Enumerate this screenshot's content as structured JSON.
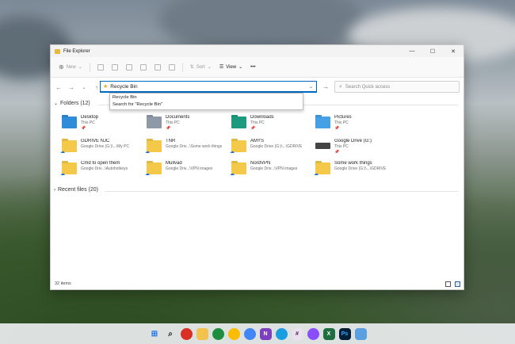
{
  "window": {
    "title": "File Explorer",
    "controls": [
      "—",
      "☐",
      "✕"
    ]
  },
  "toolbar": {
    "new_label": "New",
    "sort_label": "Sort",
    "view_label": "View",
    "more_label": "•••"
  },
  "address": {
    "value": "Recycle Bin",
    "suggestions": [
      "Recycle Bin",
      "Search for \"Recycle Bin\""
    ]
  },
  "search": {
    "placeholder": "Search Quick access"
  },
  "folders_header": "Folders (12)",
  "recent_header": "Recent files (20)",
  "folders": [
    {
      "name": "Desktop",
      "sub": "This PC",
      "pin": "📌",
      "icon": "desktop-folder-icon"
    },
    {
      "name": "Documents",
      "sub": "This PC",
      "pin": "📌",
      "icon": "documents-folder-icon"
    },
    {
      "name": "Downloads",
      "sub": "This PC",
      "pin": "📌",
      "icon": "downloads-folder-icon"
    },
    {
      "name": "Pictures",
      "sub": "This PC",
      "pin": "📌",
      "icon": "pictures-folder-icon"
    },
    {
      "name": "GDRIVE NJC",
      "sub": "Google Drive (G:)\\...\\My PC",
      "pin": "",
      "icon": "cloud-folder-icon"
    },
    {
      "name": "TNR",
      "sub": "Google Driv...\\Some work things",
      "pin": "",
      "icon": "cloud-folder-icon"
    },
    {
      "name": "AMYS",
      "sub": "Google Drive (G:)\\...\\GDRIVE",
      "pin": "",
      "icon": "cloud-folder-icon"
    },
    {
      "name": "Google Drive (G:)",
      "sub": "This PC",
      "pin": "📌",
      "icon": "drive-icon"
    },
    {
      "name": "Cmd to open them",
      "sub": "Google Driv...\\Autohotkeys",
      "pin": "",
      "icon": "cloud-folder-icon"
    },
    {
      "name": "Mullvad",
      "sub": "Google Driv...\\VPN images",
      "pin": "",
      "icon": "cloud-folder-icon"
    },
    {
      "name": "NordVPN",
      "sub": "Google Driv...\\VPN images",
      "pin": "",
      "icon": "cloud-folder-icon"
    },
    {
      "name": "Some work things",
      "sub": "Google Drive (G:)\\...\\GDRIVE",
      "pin": "",
      "icon": "cloud-folder-icon"
    }
  ],
  "status": {
    "items": "32 items"
  },
  "taskbar": [
    "windows-start-icon",
    "search-icon",
    "chrome-icon",
    "file-explorer-icon",
    "chrome-icon",
    "chrome-icon",
    "chrome-icon",
    "onenote-icon",
    "edge-icon",
    "slack-icon",
    "messenger-icon",
    "excel-icon",
    "photoshop-icon",
    "notepad-icon"
  ]
}
